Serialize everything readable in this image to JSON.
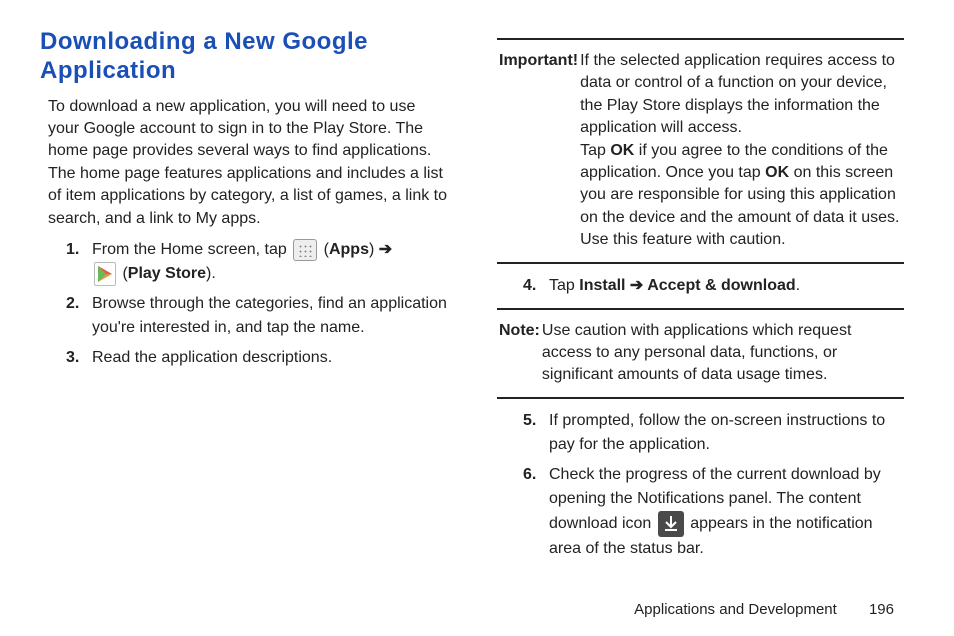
{
  "heading": "Downloading a New Google Application",
  "intro": "To download a new application, you will need to use your Google account to sign in to the Play Store. The home page provides several ways to find applications. The home page features applications and includes a list of item applications by category, a list of games, a link to search, and a link to My apps.",
  "steps": {
    "s1_pre": "From the Home screen, tap ",
    "s1_apps": "Apps",
    "s1_arrow": " ➔",
    "s1_ps": "Play Store",
    "s2": "Browse through the categories, find an application you're interested in, and tap the name.",
    "s3": "Read the application descriptions.",
    "s4_pre": "Tap ",
    "s4_b1": "Install ➔ Accept & download",
    "s4_post": ".",
    "s5": "If prompted, follow the on-screen instructions to pay for the application.",
    "s6_pre": "Check the progress of the current download by opening the Notifications panel. The content download icon ",
    "s6_post": " appears in the notification area of the status bar."
  },
  "important": {
    "label": "Important!",
    "p1": "If the selected application requires access to data or control of a function on your device, the Play Store displays the information the application will access.",
    "p2a": "Tap ",
    "p2ok1": "OK",
    "p2b": " if you agree to the conditions of the application. Once you tap ",
    "p2ok2": "OK",
    "p2c": " on this screen you are responsible for using this application on the device and the amount of data it uses. Use this feature with caution."
  },
  "note": {
    "label": "Note:",
    "body": "Use caution with applications which request access to any personal data, functions, or significant amounts of data usage times."
  },
  "footer": {
    "section": "Applications and Development",
    "page": "196"
  }
}
